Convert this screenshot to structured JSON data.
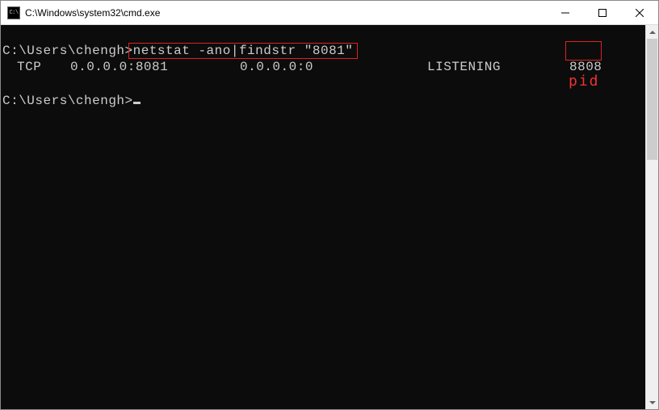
{
  "window": {
    "title": "C:\\Windows\\system32\\cmd.exe",
    "icon_label": "C:\\"
  },
  "terminal": {
    "prompt1": "C:\\Users\\chengh>",
    "command": "netstat -ano|findstr \"8081\"",
    "output": {
      "proto": "TCP",
      "local_addr": "0.0.0.0:8081",
      "foreign_addr": "0.0.0.0:0",
      "state": "LISTENING",
      "pid": "8808"
    },
    "prompt2": "C:\\Users\\chengh>"
  },
  "annotations": {
    "pid_label": "pid"
  }
}
